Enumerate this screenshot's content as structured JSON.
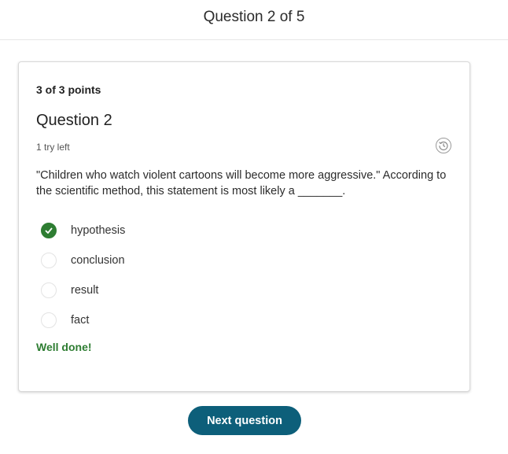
{
  "header": {
    "title": "Question 2 of 5"
  },
  "card": {
    "points": "3 of 3 points",
    "title": "Question 2",
    "tries": "1 try left",
    "question": "\"Children who watch violent cartoons will become more aggressive.\" According to the scientific method, this statement is most likely a _______.",
    "options": [
      {
        "label": "hypothesis",
        "selected": true
      },
      {
        "label": "conclusion",
        "selected": false
      },
      {
        "label": "result",
        "selected": false
      },
      {
        "label": "fact",
        "selected": false
      }
    ],
    "feedback": "Well done!"
  },
  "footer": {
    "next_label": "Next question"
  },
  "colors": {
    "correct": "#2e7d32",
    "button": "#0d5f7a"
  },
  "icons": {
    "history": "history-icon",
    "check": "check-icon"
  }
}
